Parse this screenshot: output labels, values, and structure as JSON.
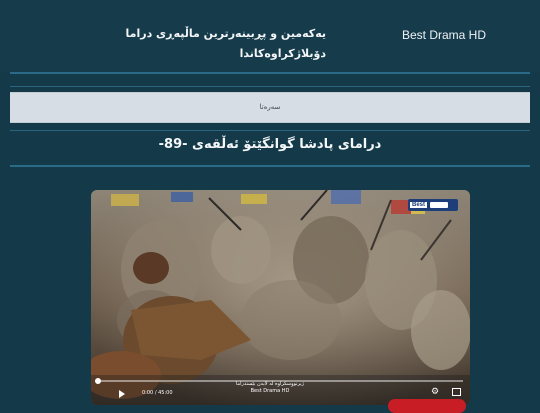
{
  "header": {
    "brand": "Best Drama HD",
    "tagline": "یەکەمین و پڕبینەرترین ماڵپەڕی دراما دۆبلاژکراوەکاندا"
  },
  "nav": {
    "home_label": "سەرەتا"
  },
  "page": {
    "title": "درامای پادشا گوانگێتۆ ئەڵقەی -89-"
  },
  "player": {
    "channel_badge": "Best",
    "subtitle_line1": "ژیرنووسکراوە لە لایەن بێستدراما",
    "subtitle_line2": "Best Drama HD",
    "time": "0:00 / 45:00",
    "progress": 0.0
  }
}
